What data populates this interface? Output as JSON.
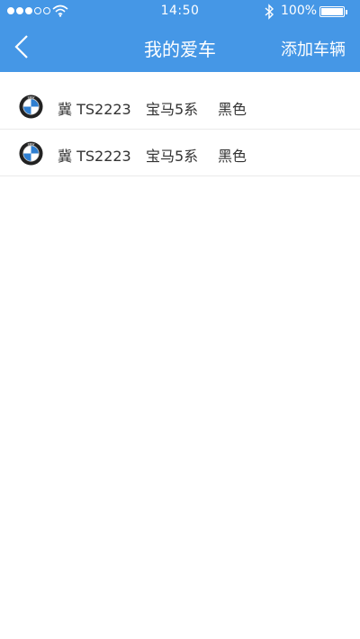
{
  "status_bar": {
    "time": "14:50",
    "battery": "100%",
    "signal_strength": "3 of 5",
    "icons": [
      "signal-dots-icon",
      "wifi-icon",
      "bluetooth-icon",
      "battery-icon"
    ]
  },
  "nav": {
    "back_icon": "chevron-left-icon",
    "title": "我的爱车",
    "add_label": "添加车辆",
    "background_color": "#4597e6"
  },
  "cars": [
    {
      "logo_icon": "bmw-logo-icon",
      "plate": "冀 TS2223",
      "model": "宝马5系",
      "color": "黑色"
    },
    {
      "logo_icon": "bmw-logo-icon",
      "plate": "冀 TS2223",
      "model": "宝马5系",
      "color": "黑色"
    }
  ]
}
